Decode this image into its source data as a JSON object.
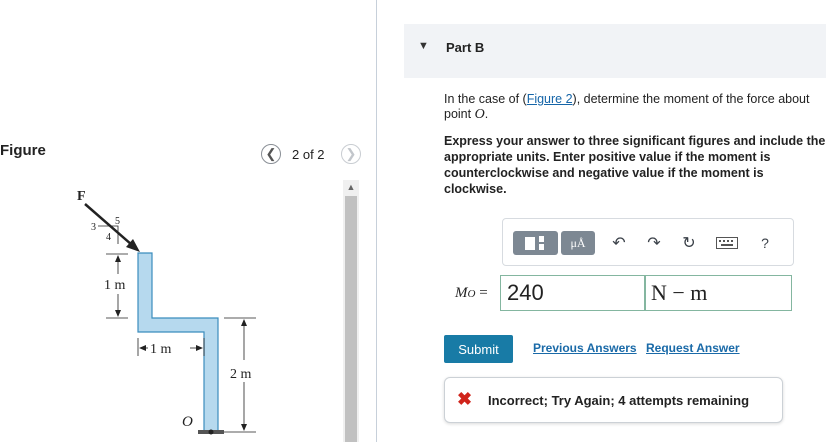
{
  "figure_pane": {
    "title": "Figure",
    "pager": {
      "text": "2 of 2",
      "prev_icon": "chevron-left",
      "next_icon": "chevron-right"
    },
    "diagram": {
      "force_label": "F",
      "slope": {
        "a": "3",
        "b": "4",
        "c": "5"
      },
      "dim_vertical_top": "1 m",
      "dim_horizontal": "1 m",
      "dim_vertical_right": "2 m",
      "point_label": "O",
      "bar_color": "#b6d9ee"
    }
  },
  "part": {
    "title": "Part B",
    "caret_icon": "caret-down"
  },
  "question": {
    "text_before": "In the case of (",
    "link": "Figure 2",
    "text_after": "), determine the moment of the force about point ",
    "point": "O",
    "period": ".",
    "instructions": "Express your answer to three significant figures and include the appropriate units. Enter positive value if the moment is counterclockwise and negative value if the moment is clockwise."
  },
  "toolbar": {
    "units_label": "μÅ",
    "help_label": "?",
    "icons": [
      "templates-icon",
      "units-icon",
      "undo-icon",
      "redo-icon",
      "reset-icon",
      "keyboard-icon",
      "help-icon"
    ]
  },
  "answer": {
    "label_main": "M",
    "label_sub": "O",
    "label_eq": " =",
    "value": "240",
    "units": "N − m"
  },
  "actions": {
    "submit": "Submit",
    "previous_answers": "Previous Answers",
    "request_answer": "Request Answer"
  },
  "feedback": {
    "icon": "x-icon",
    "text": "Incorrect; Try Again; 4 attempts remaining",
    "color": "#d0241b"
  },
  "colors": {
    "accent": "#187ba6",
    "link": "#1a6aa8",
    "input_border": "#84b6a0"
  }
}
